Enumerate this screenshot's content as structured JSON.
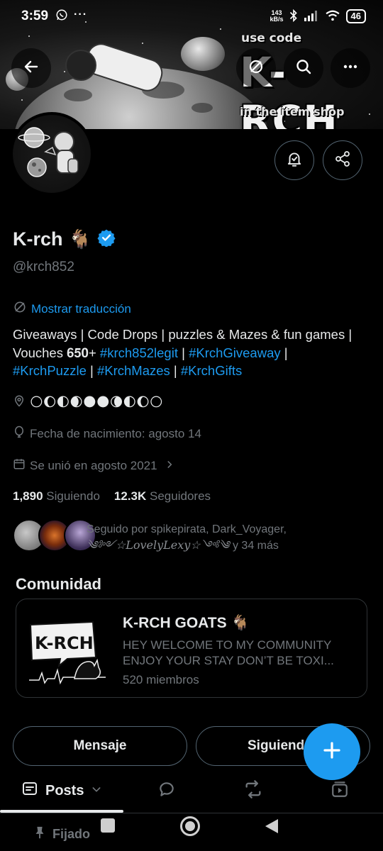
{
  "status_bar": {
    "time": "3:59",
    "net_speed_top": "143",
    "net_speed_bottom": "kB/s",
    "battery": "46"
  },
  "banner": {
    "line1": "use code",
    "big": "K-RCH",
    "line3": "in the item shop"
  },
  "profile": {
    "name": "K-rch",
    "name_emoji": "🐐",
    "handle": "@krch852",
    "translate_label": "Mostrar traducción",
    "bio_line1": "Giveaways | Code Drops | puzzles & Mazes & fun games |",
    "bio_vouches": "Vouches 𝟔𝟓𝟎+ ",
    "bio_tags": [
      "#krch852legit",
      "#KrchGiveaway",
      "#KrchPuzzle",
      "#KrchMazes",
      "#KrchGifts"
    ],
    "location": "🌕🌔🌓🌒🌑🌑🌘🌓🌔🌕",
    "birthday": "Fecha de nacimiento: agosto 14",
    "joined": "Se unió en agosto 2021"
  },
  "counts": {
    "following_value": "1,890",
    "following_label": "Siguiendo",
    "followers_value": "12.3K",
    "followers_label": "Seguidores"
  },
  "followed_by": {
    "line1": "Seguido por spikepirata, Dark_Voyager,",
    "line2_name": "༄༻☆𝐿𝑜𝑣𝑒𝑙𝑦𝐿𝑒𝑥𝑦☆༺༄",
    "line2_rest": " y 34 más"
  },
  "community": {
    "section_title": "Comunidad",
    "image_text": "K-RCH",
    "name": "K-RCH GOATS",
    "name_emoji": "🐐",
    "desc_line1": "HEY WELCOME TO MY COMMUNITY",
    "desc_line2": "ENJOY YOUR STAY DON’T BE TOXI...",
    "members": "520 miembros"
  },
  "actions": {
    "message": "Mensaje",
    "following": "Siguiendo"
  },
  "tabs": {
    "posts": "Posts"
  },
  "pinned_label": "Fijado",
  "colors": {
    "accent": "#1d9bf0",
    "text": "#e7e9ea",
    "secondary": "#71767b",
    "border": "#2f3336",
    "background": "#000000"
  }
}
